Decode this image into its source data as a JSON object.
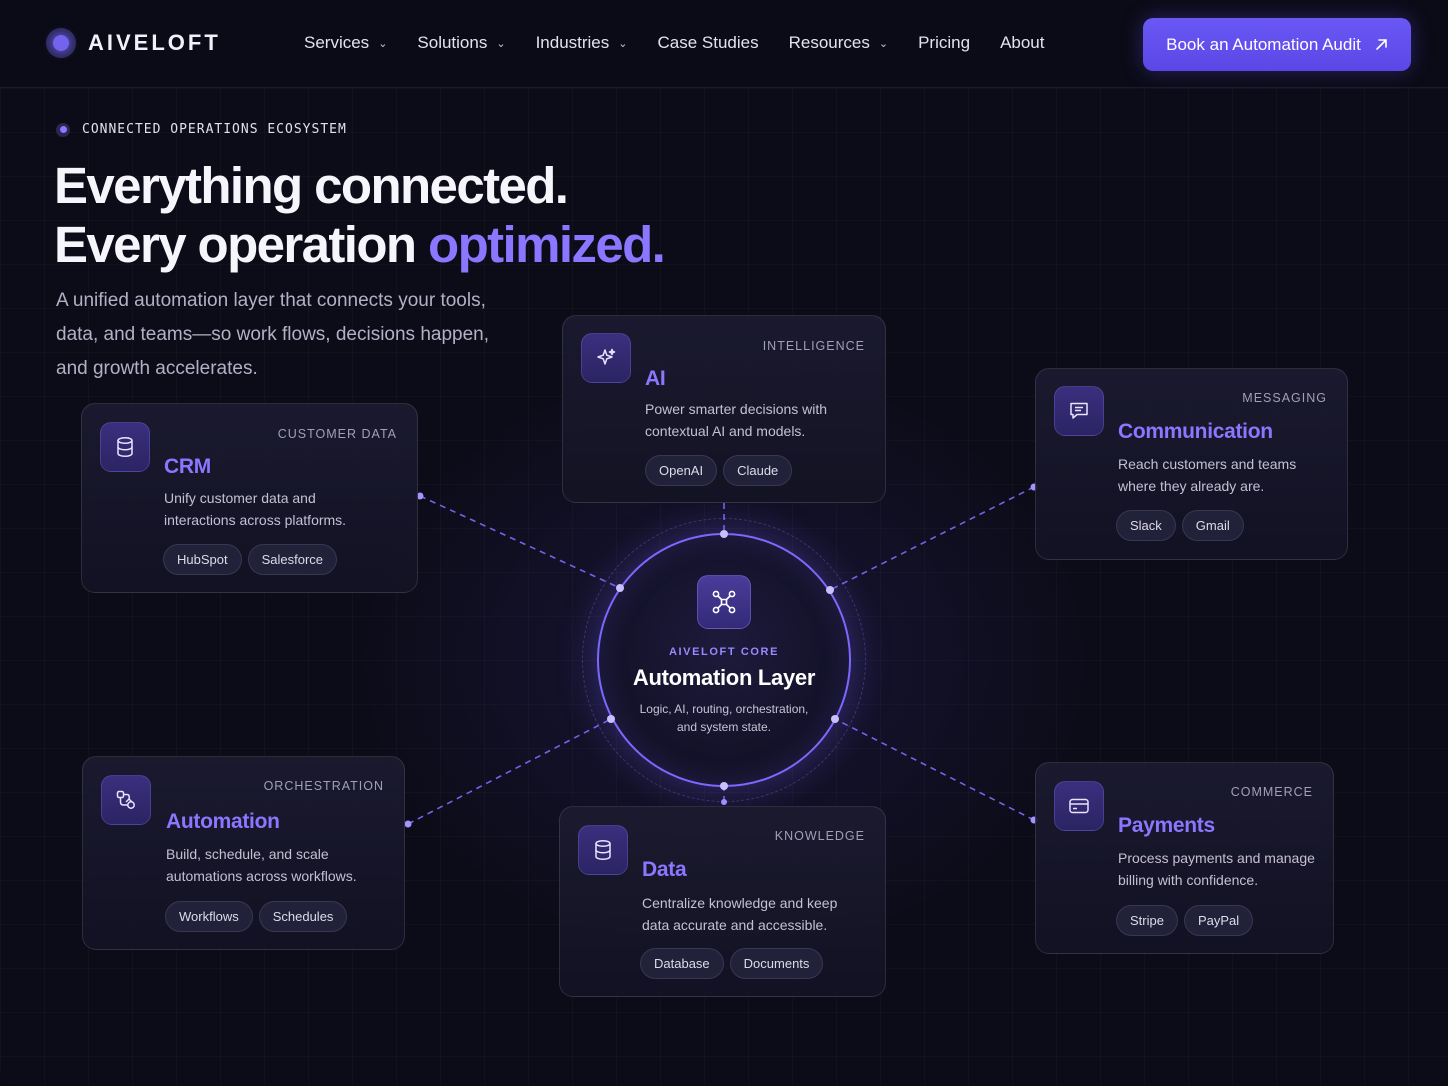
{
  "brand": {
    "name": "AIVELOFT",
    "accent": "#7563f0"
  },
  "nav": {
    "items": [
      {
        "label": "Services",
        "dropdown": true
      },
      {
        "label": "Solutions",
        "dropdown": true
      },
      {
        "label": "Industries",
        "dropdown": true
      },
      {
        "label": "Case Studies",
        "dropdown": false
      },
      {
        "label": "Resources",
        "dropdown": true
      },
      {
        "label": "Pricing",
        "dropdown": false
      },
      {
        "label": "About",
        "dropdown": false
      }
    ],
    "cta_label": "Book an Automation Audit"
  },
  "hero": {
    "eyebrow": "CONNECTED OPERATIONS ECOSYSTEM",
    "headline_line1": "Everything connected.",
    "headline_line2_prefix": "Every operation ",
    "headline_line2_accent": "optimized.",
    "subtext": "A unified automation layer that connects your tools, data, and teams—so work flows, decisions happen, and growth accelerates."
  },
  "core": {
    "label": "AIVELOFT CORE",
    "title": "Automation Layer",
    "description": "Logic, AI, routing, orchestration, and system state.",
    "icon": "network-nodes-icon"
  },
  "cards": {
    "ai": {
      "category": "INTELLIGENCE",
      "title": "AI",
      "description": "Power smarter decisions with contextual AI and models.",
      "tags": [
        "OpenAI",
        "Claude"
      ],
      "icon": "sparkle-icon"
    },
    "crm": {
      "category": "CUSTOMER DATA",
      "title": "CRM",
      "description": "Unify customer data and interactions across platforms.",
      "tags": [
        "HubSpot",
        "Salesforce"
      ],
      "icon": "database-icon"
    },
    "communication": {
      "category": "MESSAGING",
      "title": "Communication",
      "description": "Reach customers and teams where they already are.",
      "tags": [
        "Slack",
        "Gmail"
      ],
      "icon": "chat-icon"
    },
    "automation": {
      "category": "ORCHESTRATION",
      "title": "Automation",
      "description": "Build, schedule, and scale automations across workflows.",
      "tags": [
        "Workflows",
        "Schedules"
      ],
      "icon": "workflow-icon"
    },
    "data": {
      "category": "KNOWLEDGE",
      "title": "Data",
      "description": "Centralize knowledge and keep data accurate and accessible.",
      "tags": [
        "Database",
        "Documents"
      ],
      "icon": "database-icon"
    },
    "payments": {
      "category": "COMMERCE",
      "title": "Payments",
      "description": "Process payments and manage billing with confidence.",
      "tags": [
        "Stripe",
        "PayPal"
      ],
      "icon": "credit-card-icon"
    }
  }
}
